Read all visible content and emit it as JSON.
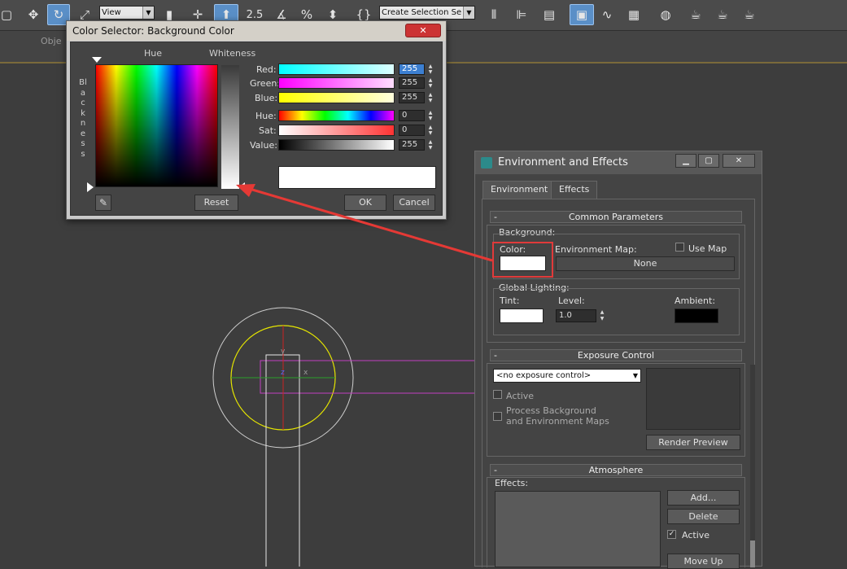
{
  "toolbar": {
    "view_select": "View",
    "numeric": "2.5",
    "selection_set_placeholder": "Create Selection Se"
  },
  "ribbon": {
    "label": "Obje"
  },
  "color_selector": {
    "title": "Color Selector: Background Color",
    "close_label": "✕",
    "hue_label": "Hue",
    "whiteness_label": "Whiteness",
    "blackness_label": "Blackness",
    "red_label": "Red:",
    "green_label": "Green:",
    "blue_label": "Blue:",
    "hue_field_label": "Hue:",
    "sat_label": "Sat:",
    "value_label": "Value:",
    "red": "255",
    "green": "255",
    "blue": "255",
    "hue": "0",
    "sat": "0",
    "value": "255",
    "reset_label": "Reset",
    "ok_label": "OK",
    "cancel_label": "Cancel",
    "current_color": "#ffffff"
  },
  "env_effects": {
    "title": "Environment and Effects",
    "tabs": [
      "Environment",
      "Effects"
    ],
    "common_parameters": "Common Parameters",
    "background_label": "Background:",
    "color_label": "Color:",
    "env_map_label": "Environment Map:",
    "use_map_label": "Use Map",
    "none_button": "None",
    "global_lighting_label": "Global Lighting:",
    "tint_label": "Tint:",
    "level_label": "Level:",
    "level_value": "1.0",
    "ambient_label": "Ambient:",
    "exposure_control": "Exposure Control",
    "exposure_select": "<no exposure control>",
    "active_label": "Active",
    "process_bg_label_1": "Process Background",
    "process_bg_label_2": "and Environment Maps",
    "render_preview_label": "Render Preview",
    "atmosphere": "Atmosphere",
    "effects_label": "Effects:",
    "add_label": "Add...",
    "delete_label": "Delete",
    "atm_active_label": "Active",
    "move_up_label": "Move Up",
    "background_color": "#ffffff",
    "tint_color": "#ffffff",
    "ambient_color": "#000000"
  },
  "viewport": {
    "axis_y": "y",
    "axis_z": "z",
    "axis_x": "x"
  }
}
